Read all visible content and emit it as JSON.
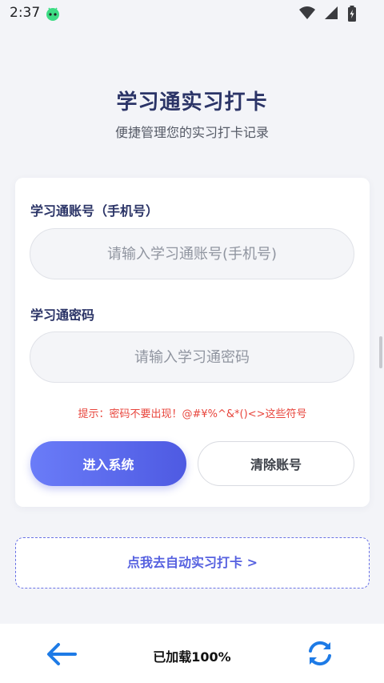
{
  "status_bar": {
    "time": "2:37"
  },
  "header": {
    "title": "学习通实习打卡",
    "subtitle": "便捷管理您的实习打卡记录"
  },
  "form": {
    "account_label": "学习通账号（手机号）",
    "account_placeholder": "请输入学习通账号(手机号)",
    "account_value": "",
    "password_label": "学习通密码",
    "password_placeholder": "请输入学习通密码",
    "password_value": "",
    "hint": "提示：密码不要出现！@#¥%^&*()<>这些符号",
    "enter_button": "进入系统",
    "clear_button": "清除账号"
  },
  "auto_checkin_link": "点我去自动实习打卡 >",
  "bottom_bar": {
    "status": "已加载100%"
  },
  "colors": {
    "title": "#2b3467",
    "accent": "#5661e0",
    "hint": "#e8453c",
    "icon_blue": "#1e7be6",
    "background": "#f3f4f8"
  },
  "icons": {
    "app_status": "android-robot-icon",
    "wifi": "wifi-icon",
    "signal": "signal-icon",
    "battery": "battery-icon",
    "back": "arrow-left-icon",
    "refresh": "refresh-icon"
  }
}
